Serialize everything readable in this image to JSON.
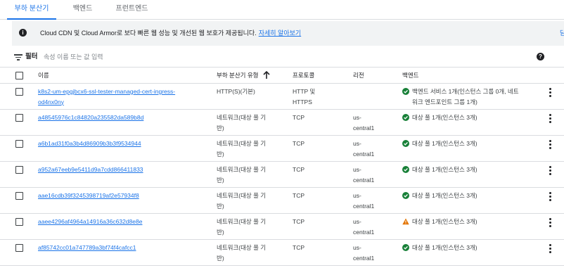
{
  "tabs": [
    {
      "label": "부하 분산기",
      "active": true
    },
    {
      "label": "백엔드",
      "active": false
    },
    {
      "label": "프런트엔드",
      "active": false
    }
  ],
  "banner": {
    "icon": "info-icon",
    "text": "Cloud CDN 및 Cloud Armor로 보다 빠른 웹 성능 및 개선된 웹 보호가 제공됩니다.",
    "link": "자세히 알아보기",
    "edge_fragment": "닫"
  },
  "filter": {
    "label": "필터",
    "placeholder": "속성 이름 또는 값 입력"
  },
  "table": {
    "headers": {
      "name": "이름",
      "type": "부하 분산기 유형",
      "protocol": "프로토콜",
      "region": "리전",
      "backend": "백엔드"
    },
    "sort_column": "type",
    "sort_direction": "ascending",
    "rows": [
      {
        "name_lines": [
          "k8s2-um-epgjbcx6-ssl-tester-managed-cert-ingress-",
          "od4nx0ny"
        ],
        "type_lines": [
          "HTTP(S)(기본)"
        ],
        "protocol_lines": [
          "HTTP 및",
          "HTTPS"
        ],
        "region_lines": [
          ""
        ],
        "status": "ok",
        "backend_lines": [
          "백엔드 서비스 1개(인스턴스 그룹 0개, 네트",
          "워크 엔드포인트 그룹 1개)"
        ]
      },
      {
        "name_lines": [
          "a48545976c1c84820a235582da589b8d"
        ],
        "type_lines": [
          "네트워크(대상 풀 기",
          "반)"
        ],
        "protocol_lines": [
          "TCP"
        ],
        "region_lines": [
          "us-",
          "central1"
        ],
        "status": "ok",
        "backend_lines": [
          "대상 풀 1개(인스턴스 3개)"
        ]
      },
      {
        "name_lines": [
          "a6b1ad31f0a3b4d86909b3b3f9534944"
        ],
        "type_lines": [
          "네트워크(대상 풀 기",
          "반)"
        ],
        "protocol_lines": [
          "TCP"
        ],
        "region_lines": [
          "us-",
          "central1"
        ],
        "status": "ok",
        "backend_lines": [
          "대상 풀 1개(인스턴스 3개)"
        ]
      },
      {
        "name_lines": [
          "a952a67eeb9e5411d9a7cdd866411833"
        ],
        "type_lines": [
          "네트워크(대상 풀 기",
          "반)"
        ],
        "protocol_lines": [
          "TCP"
        ],
        "region_lines": [
          "us-",
          "central1"
        ],
        "status": "ok",
        "backend_lines": [
          "대상 풀 1개(인스턴스 3개)"
        ]
      },
      {
        "name_lines": [
          "aae16cdb39f3245398719af2e57934f8"
        ],
        "type_lines": [
          "네트워크(대상 풀 기",
          "반)"
        ],
        "protocol_lines": [
          "TCP"
        ],
        "region_lines": [
          "us-",
          "central1"
        ],
        "status": "ok",
        "backend_lines": [
          "대상 풀 1개(인스턴스 3개)"
        ]
      },
      {
        "name_lines": [
          "aaee4296af4964a14916a36c632d8e8e"
        ],
        "type_lines": [
          "네트워크(대상 풀 기",
          "반)"
        ],
        "protocol_lines": [
          "TCP"
        ],
        "region_lines": [
          "us-",
          "central1"
        ],
        "status": "warning",
        "backend_lines": [
          "대상 풀 1개(인스턴스 3개)"
        ]
      },
      {
        "name_lines": [
          "af85742cc01a747789a3bf74f4cafcc1"
        ],
        "type_lines": [
          "네트워크(대상 풀 기",
          "반)"
        ],
        "protocol_lines": [
          "TCP"
        ],
        "region_lines": [
          "us-",
          "central1"
        ],
        "status": "ok",
        "backend_lines": [
          "대상 풀 1개(인스턴스 3개)"
        ]
      }
    ]
  },
  "colors": {
    "accent": "#1a73e8",
    "ok": "#188038",
    "warning": "#e37400",
    "border": "#dadce0"
  }
}
